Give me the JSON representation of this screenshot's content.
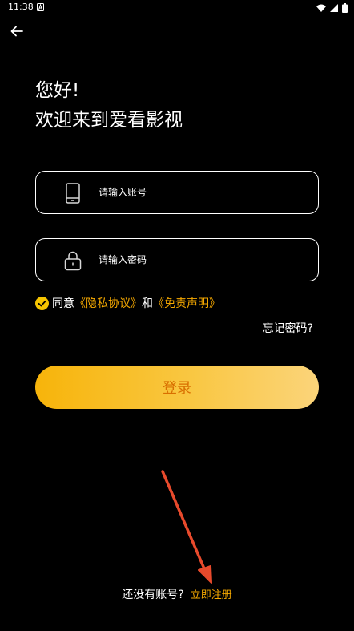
{
  "status_bar": {
    "time": "11:38",
    "notification_icon": "a-notification-icon",
    "wifi_icon": "wifi-icon",
    "signal_icon": "signal-icon",
    "battery_icon": "battery-icon"
  },
  "header": {
    "back_icon": "back-arrow-icon"
  },
  "greeting": {
    "line1": "您好!",
    "line2": "欢迎来到爱看影视"
  },
  "form": {
    "account_placeholder": "请输入账号",
    "account_icon": "phone-icon",
    "password_placeholder": "请输入密码",
    "password_icon": "lock-icon"
  },
  "agreement": {
    "prefix": "同意",
    "privacy_link": "《隐私协议》",
    "conjunction": "和",
    "disclaimer_link": "《免责声明》",
    "checked": true
  },
  "forgot_password": "忘记密码?",
  "login_button": "登录",
  "register": {
    "prompt": "还没有账号?",
    "link": "立即注册"
  },
  "colors": {
    "background": "#000000",
    "accent": "#f5a800",
    "login_gradient_start": "#f7b40a",
    "login_gradient_end": "#fbd47a",
    "login_text": "#d96f00",
    "annotation_arrow": "#e84a2c"
  }
}
